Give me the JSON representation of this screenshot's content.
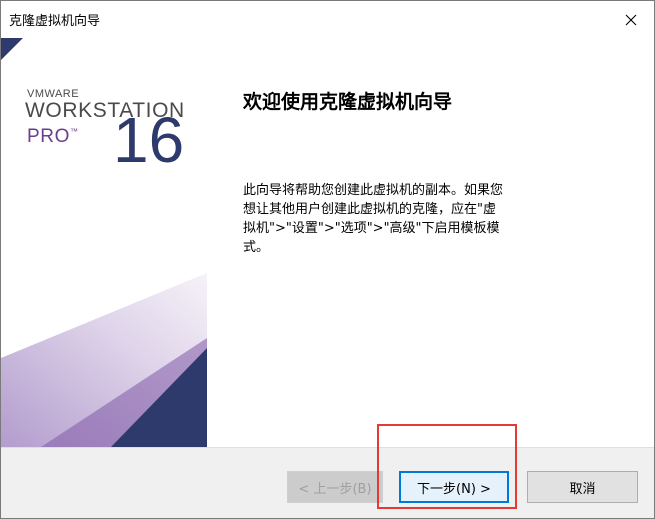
{
  "window": {
    "title": "克隆虚拟机向导"
  },
  "banner": {
    "vmware": "VMWARE",
    "workstation": "WORKSTATION",
    "pro": "PRO",
    "tm": "™",
    "version": "16",
    "colors": {
      "purple": "#6a3d8e",
      "navy": "#2d3a6b",
      "lavender": "#c8b7d9"
    }
  },
  "content": {
    "heading": "欢迎使用克隆虚拟机向导",
    "description": "此向导将帮助您创建此虚拟机的副本。如果您想让其他用户创建此虚拟机的克隆，应在\"虚拟机\">\"设置\">\"选项\">\"高级\"下启用模板模式。"
  },
  "buttons": {
    "back_label": "< 上一步(B)",
    "next_label": "下一步(N) >",
    "cancel_label": "取消"
  },
  "icons": {
    "close": "close-icon"
  },
  "colors": {
    "highlight": "#e53935",
    "focus": "#0078d7"
  }
}
